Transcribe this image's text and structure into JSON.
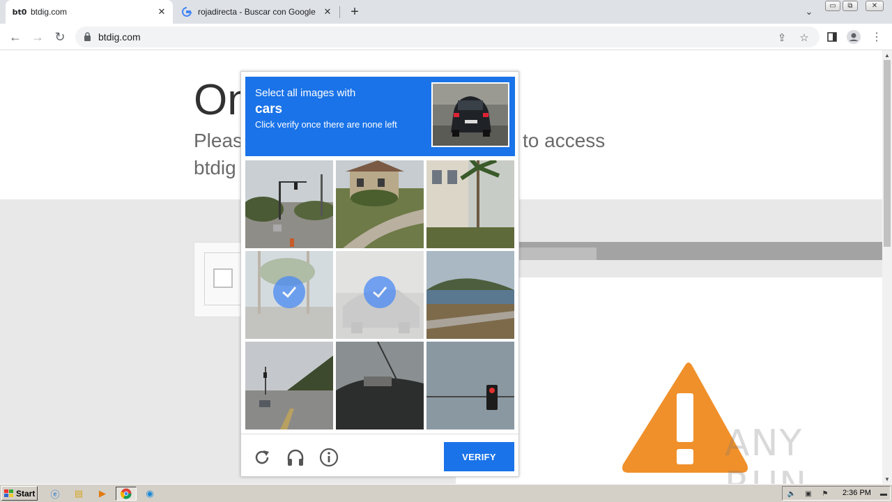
{
  "browser": {
    "tabs": [
      {
        "title": "btdig.com",
        "favicon": "bt0"
      },
      {
        "title": "rojadirecta - Buscar con Google",
        "favicon": "G"
      }
    ],
    "url": "btdig.com"
  },
  "page": {
    "heading": "On",
    "subtext_line1_left": "Pleas",
    "subtext_line1_right": "to access",
    "subtext_line2": "btdig"
  },
  "captcha": {
    "instruction": "Select all images with",
    "target": "cars",
    "hint": "Click verify once there are none left",
    "verify_label": "VERIFY",
    "tiles": [
      {
        "scene": "intersection-palm",
        "selected": false
      },
      {
        "scene": "house-lawn",
        "selected": false
      },
      {
        "scene": "building-palm",
        "selected": false
      },
      {
        "scene": "palm-street",
        "selected": true
      },
      {
        "scene": "parked-car",
        "selected": true
      },
      {
        "scene": "coastline",
        "selected": false
      },
      {
        "scene": "highway-car",
        "selected": false
      },
      {
        "scene": "car-closeup",
        "selected": false
      },
      {
        "scene": "traffic-light",
        "selected": false
      }
    ]
  },
  "watermark": "ANY RUN",
  "taskbar": {
    "start_label": "Start",
    "clock": "2:36 PM"
  },
  "colors": {
    "accent": "#1a73e8",
    "warning": "#f0902a"
  }
}
